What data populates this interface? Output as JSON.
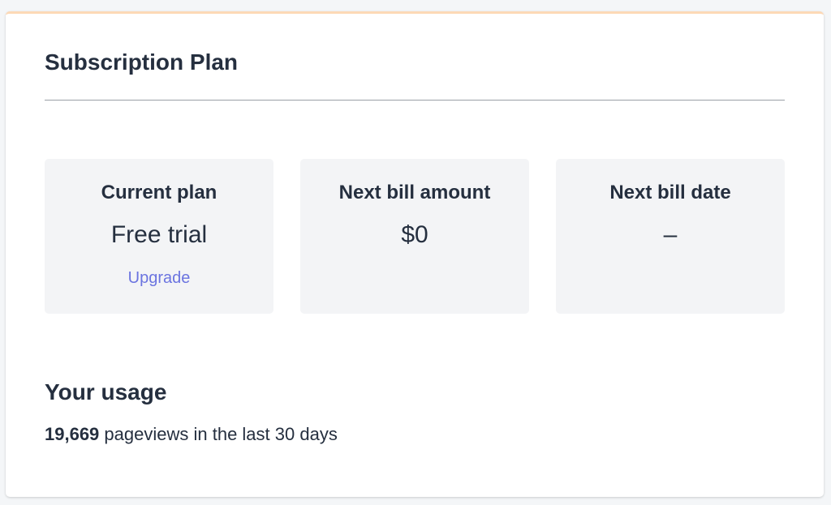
{
  "section": {
    "title": "Subscription Plan"
  },
  "stats": [
    {
      "label": "Current plan",
      "value": "Free trial",
      "action": "Upgrade"
    },
    {
      "label": "Next bill amount",
      "value": "$0"
    },
    {
      "label": "Next bill date",
      "value": "–"
    }
  ],
  "usage": {
    "title": "Your usage",
    "count": "19,669",
    "text": "pageviews in the last 30 days"
  },
  "colors": {
    "accent_border": "#fcd9b6",
    "link": "#6b74e0",
    "stat_background": "#f3f4f6",
    "text": "#252f3f"
  }
}
